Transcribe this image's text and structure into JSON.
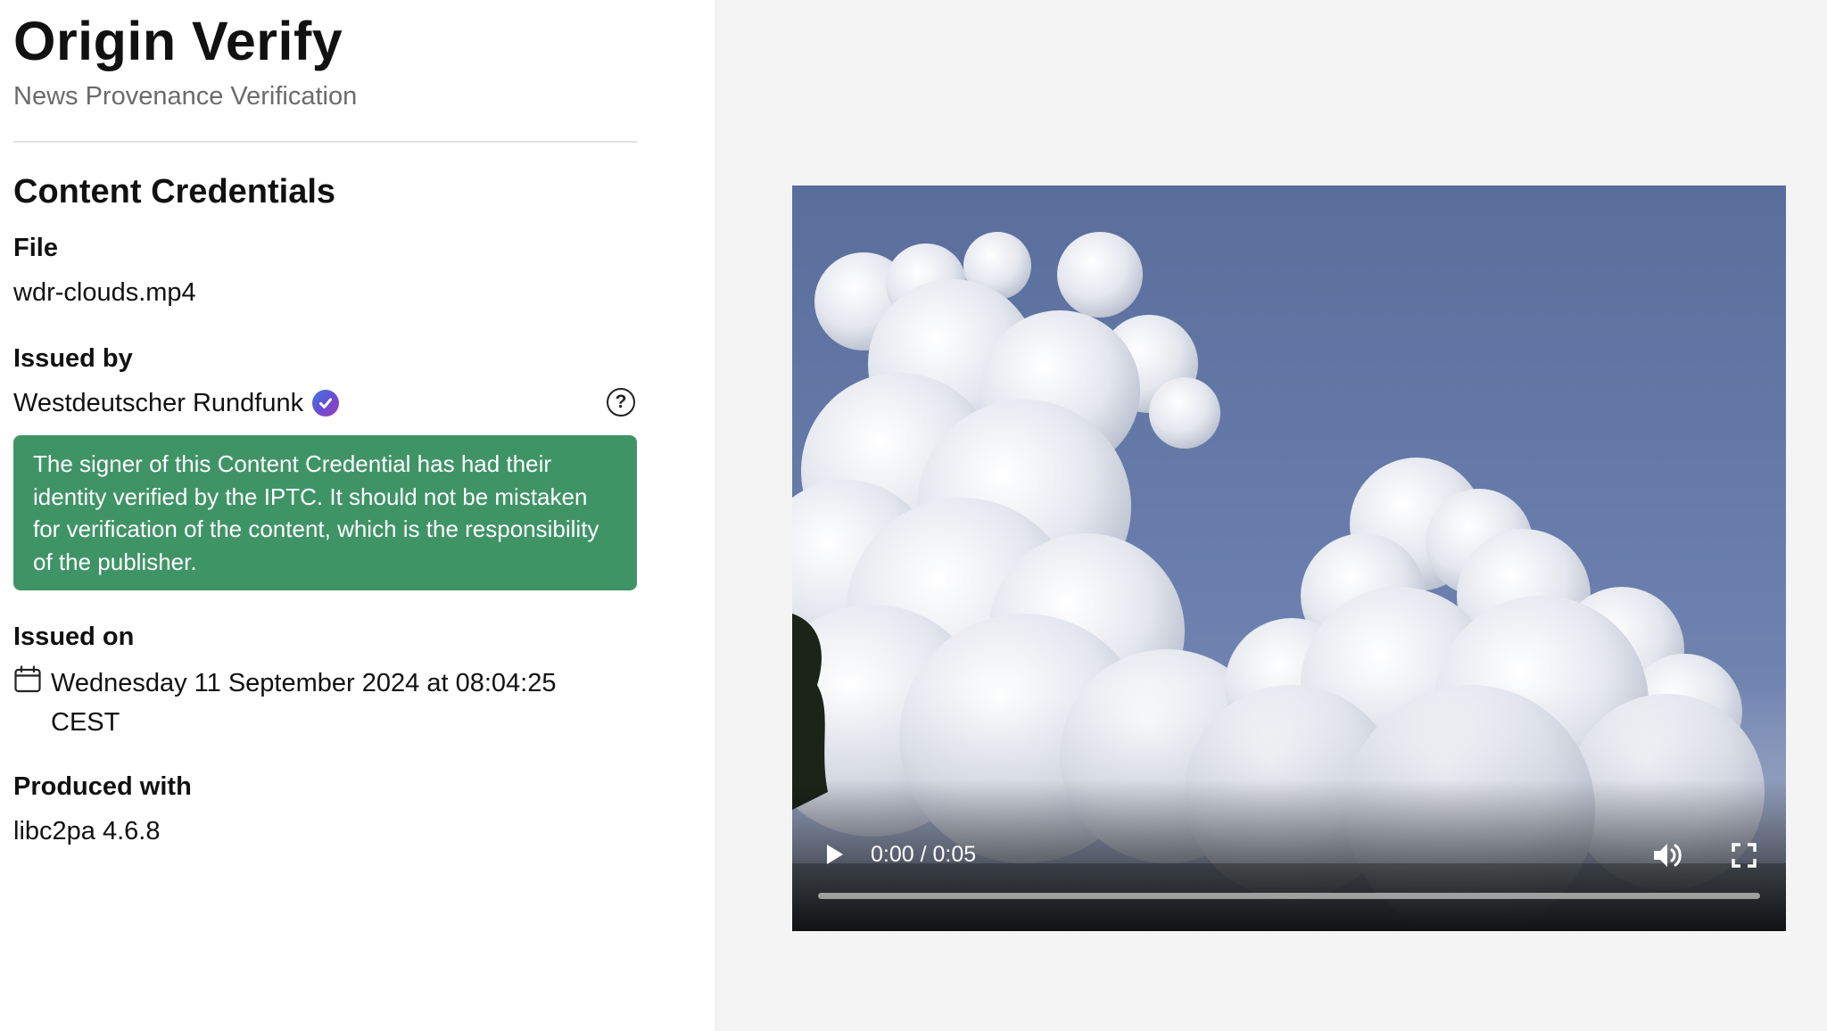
{
  "header": {
    "title": "Origin Verify",
    "subtitle": "News Provenance Verification"
  },
  "credentials": {
    "section_title": "Content Credentials",
    "file_label": "File",
    "file_value": "wdr-clouds.mp4",
    "issued_by_label": "Issued by",
    "issuer_name": "Westdeutscher Rundfunk",
    "help_glyph": "?",
    "verified_notice": "The signer of this Content Credential has had their identity verified by the IPTC. It should not be mistaken for verification of the content, which is the responsibility of the publisher.",
    "issued_on_label": "Issued on",
    "issued_on_value": "Wednesday 11 September 2024 at 08:04:25 CEST",
    "produced_with_label": "Produced with",
    "produced_with_value": "libc2pa 4.6.8"
  },
  "video": {
    "time_display": "0:00 / 0:05",
    "progress": 0
  },
  "icons": {
    "verified": "verified-check-icon",
    "help": "question-circle-icon",
    "calendar": "calendar-icon",
    "play": "play-icon",
    "volume": "volume-icon",
    "fullscreen": "fullscreen-icon",
    "more": "more-vertical-icon"
  },
  "colors": {
    "notice_bg": "#3f9466",
    "right_panel_bg": "#f4f4f4",
    "subtitle": "#6b6b6b",
    "sky": "#6278a8"
  }
}
